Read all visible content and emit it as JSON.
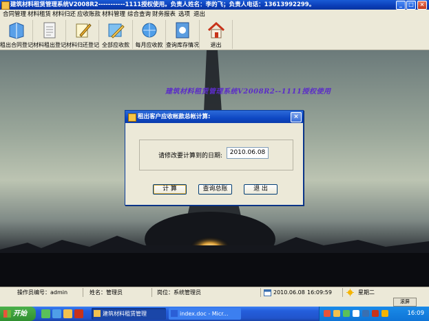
{
  "window": {
    "title": "建筑材料租赁管理系统V2008R2-----------1111授权使用。负责人姓名：李的飞；负责人电话：13613992299。",
    "min_label": "_",
    "max_label": "□",
    "close_label": "×"
  },
  "menu": [
    "合同管理",
    "材料租赁",
    "材料归还",
    "应收账款",
    "材料管理",
    "综合查询",
    "财务报表",
    "选项",
    "退出"
  ],
  "toolbar": [
    {
      "label": "租出合同登记",
      "icon": "book-icon"
    },
    {
      "label": "材料租出登记",
      "icon": "document-icon"
    },
    {
      "label": "材料归还登记",
      "icon": "pencil-note-icon"
    },
    {
      "label": "全部应收款",
      "icon": "pen-edit-icon"
    },
    {
      "label": "每月应收款",
      "icon": "globe-mail-icon"
    },
    {
      "label": "查询库存情况",
      "icon": "report-icon"
    },
    {
      "label": "退出",
      "icon": "home-exit-icon"
    }
  ],
  "background": {
    "tagline": "建筑材料租赁管理系统V2008R2--1111授权使用"
  },
  "dialog": {
    "title": "租出客户应收帐款总帐计算:",
    "close_label": "×",
    "date_label": "请修改要计算到的日期:",
    "date_value": "2010.06.08",
    "buttons": {
      "calculate": "计  算",
      "query_total": "查询总账",
      "exit": "退  出"
    }
  },
  "statusbar": {
    "operator_id_label": "操作员编号：admin",
    "name_label": "姓名：管理员",
    "position_label": "岗位：系统管理员",
    "date": "2010.06.08",
    "time": "16:09:59",
    "weekday": "星期二"
  },
  "stripe": {
    "mini_label": "滚屏"
  },
  "taskbar": {
    "start_label": "开始",
    "tasks": [
      "建筑材料租赁管理",
      "index.doc - Micr..."
    ],
    "clock": "16:09"
  },
  "colors": {
    "xp_blue": "#0a3eb8",
    "tagline_purple": "#5b2dc7",
    "start_green": "#2f8f2f"
  }
}
